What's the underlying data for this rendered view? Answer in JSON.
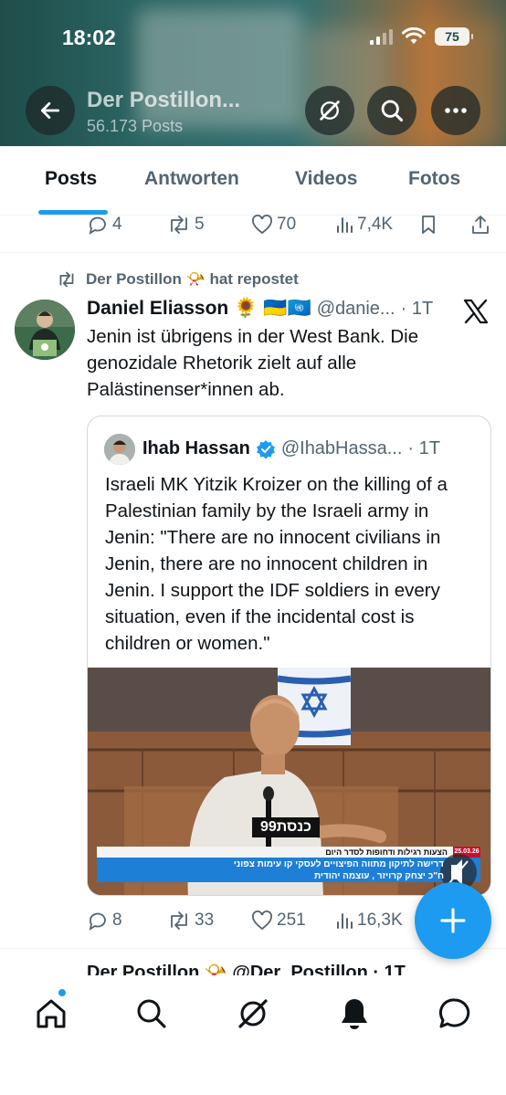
{
  "status_bar": {
    "time": "18:02",
    "battery": "75"
  },
  "profile": {
    "name": "Der Postillon...",
    "post_count": "56.173 Posts"
  },
  "tabs": [
    {
      "label": "Posts",
      "active": true
    },
    {
      "label": "Antworten",
      "active": false
    },
    {
      "label": "Videos",
      "active": false
    },
    {
      "label": "Fotos",
      "active": false
    }
  ],
  "prev_post_actions": {
    "replies": "4",
    "reposts": "5",
    "likes": "70",
    "views": "7,4K"
  },
  "repost": {
    "repost_label": "Der Postillon 📯 hat repostet",
    "author_name": "Daniel Eliasson",
    "author_emoji": "🌻",
    "author_flags": "🇺🇦🇺🇳",
    "author_handle": "@danie...",
    "time": "· 1T",
    "text": "Jenin ist übrigens in der West Bank. Die genozidale Rhetorik zielt auf alle Palästinenser*innen ab.",
    "quote": {
      "author_name": "Ihab Hassan",
      "author_handle": "@IhabHassa...",
      "time": "· 1T",
      "text": "Israeli MK Yitzik Kroizer on the killing of a Palestinian family by the Israeli army in Jenin: \"There are no innocent civilians in Jenin, there are no innocent children in Jenin. I support the IDF soldiers in every situation, even if the incidental cost is children or women.\"",
      "video_logo": "כנסת99",
      "video_caption_top": "הצעות רגילות ודחופות לסדר היום",
      "video_caption_mid": "דרישה לתיקון מתווה הפיצויים לעסקי קו עימות צפוני",
      "video_caption_bot": "ח\"כ יצחק קרויזר , עוצמה יהודית",
      "video_timestamp": "25.03.26"
    },
    "actions": {
      "replies": "8",
      "reposts": "33",
      "likes": "251",
      "views": "16,3K"
    }
  },
  "next_post": {
    "author_preview": "Der Postillon 📯 @Der_Postillon · 1T"
  },
  "colors": {
    "accent": "#1d9bf0",
    "text": "#0f1419",
    "secondary": "#536471"
  }
}
